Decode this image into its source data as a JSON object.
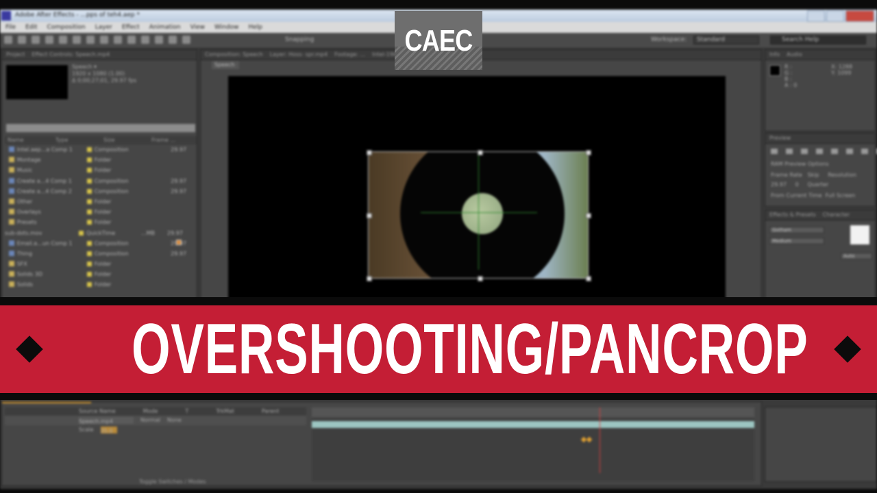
{
  "app": {
    "title": "Adobe After Effects - ...pps of teh4.aep *",
    "menu": [
      "File",
      "Edit",
      "Composition",
      "Layer",
      "Effect",
      "Animation",
      "View",
      "Window",
      "Help"
    ],
    "toolbar": {
      "snapping": "Snapping",
      "workspace_label": "Workspace:",
      "workspace_value": "Standard",
      "help_placeholder": "Search Help"
    }
  },
  "project_panel": {
    "tabs": [
      "Project",
      "Effect Controls: Speech.mp4"
    ],
    "selected_item": {
      "name": "Speech ▾",
      "size": "1920 x 1080 (1.00)",
      "duration": "Δ 0;00;27;01, 29.97 fps"
    },
    "columns": [
      "Name",
      "Type",
      "Size",
      "Frame ..."
    ],
    "rows": [
      {
        "name": "Intel.aep...a Comp 1",
        "type": "Composition",
        "fps": "29.97",
        "kind": "comp"
      },
      {
        "name": "Montage",
        "type": "Folder",
        "kind": "folder"
      },
      {
        "name": "Music",
        "type": "Folder",
        "kind": "folder"
      },
      {
        "name": "Create a...4 Comp 1",
        "type": "Composition",
        "fps": "29.97",
        "kind": "comp"
      },
      {
        "name": "Create a...4 Comp 2",
        "type": "Composition",
        "fps": "29.97",
        "kind": "comp"
      },
      {
        "name": "Other",
        "type": "Folder",
        "kind": "folder"
      },
      {
        "name": "Overlays",
        "type": "Folder",
        "kind": "folder"
      },
      {
        "name": "Presets",
        "type": "Folder",
        "kind": "folder"
      },
      {
        "name": "sub-dots.mov",
        "type": "QuickTime",
        "size": "...MB",
        "fps": "29.97",
        "kind": "footage"
      },
      {
        "name": "Email.a...un Comp 1",
        "type": "Composition",
        "fps": "29.97",
        "kind": "comp"
      },
      {
        "name": "Thing",
        "type": "Composition",
        "fps": "29.97",
        "kind": "comp"
      },
      {
        "name": "SFX",
        "type": "Folder",
        "kind": "folder"
      },
      {
        "name": "Solids 3D",
        "type": "Folder",
        "kind": "folder"
      },
      {
        "name": "Solids",
        "type": "Folder",
        "kind": "folder"
      }
    ]
  },
  "composition_panel": {
    "tabs": [
      "Composition: Speech",
      "Layer: Hoss- spr.mp4",
      "Footage: ...",
      "Intel-19kb.m.aep"
    ],
    "subtab": "Speech"
  },
  "info_panel": {
    "tabs": [
      "Info",
      "Audio"
    ],
    "rgb": [
      "R :",
      "G :",
      "B :",
      "A : 0"
    ],
    "xy": [
      "X: 1288",
      "Y: 1099"
    ]
  },
  "preview_panel": {
    "title": "Preview",
    "options": "RAM Preview Options",
    "frame_rate_label": "Frame Rate",
    "skip_label": "Skip",
    "resolution_label": "Resolution",
    "frame_rate": "29.97",
    "skip": "0",
    "resolution": "Quarter",
    "from_current": "From Current Time",
    "full_screen": "Full Screen"
  },
  "character_panel": {
    "tabs": [
      "Effects & Presets",
      "Character"
    ],
    "font": "Gotham",
    "style": "Medium",
    "size": "Auto"
  },
  "timeline_panel": {
    "columns": [
      "Source Name",
      "Mode",
      "T",
      "TrkMat",
      "Parent"
    ],
    "layers": [
      {
        "name": "Speech.mp4",
        "mode": "Normal",
        "parent": "None"
      },
      {
        "name": "Scale",
        "value": "35.0"
      }
    ],
    "toggle": "Toggle Switches / Modes",
    "playhead_fraction": 0.65
  },
  "overlay": {
    "logo": "CAEC",
    "banner": "OVERSHOOTING/PANCROP",
    "banner_color": "#c41e35"
  }
}
